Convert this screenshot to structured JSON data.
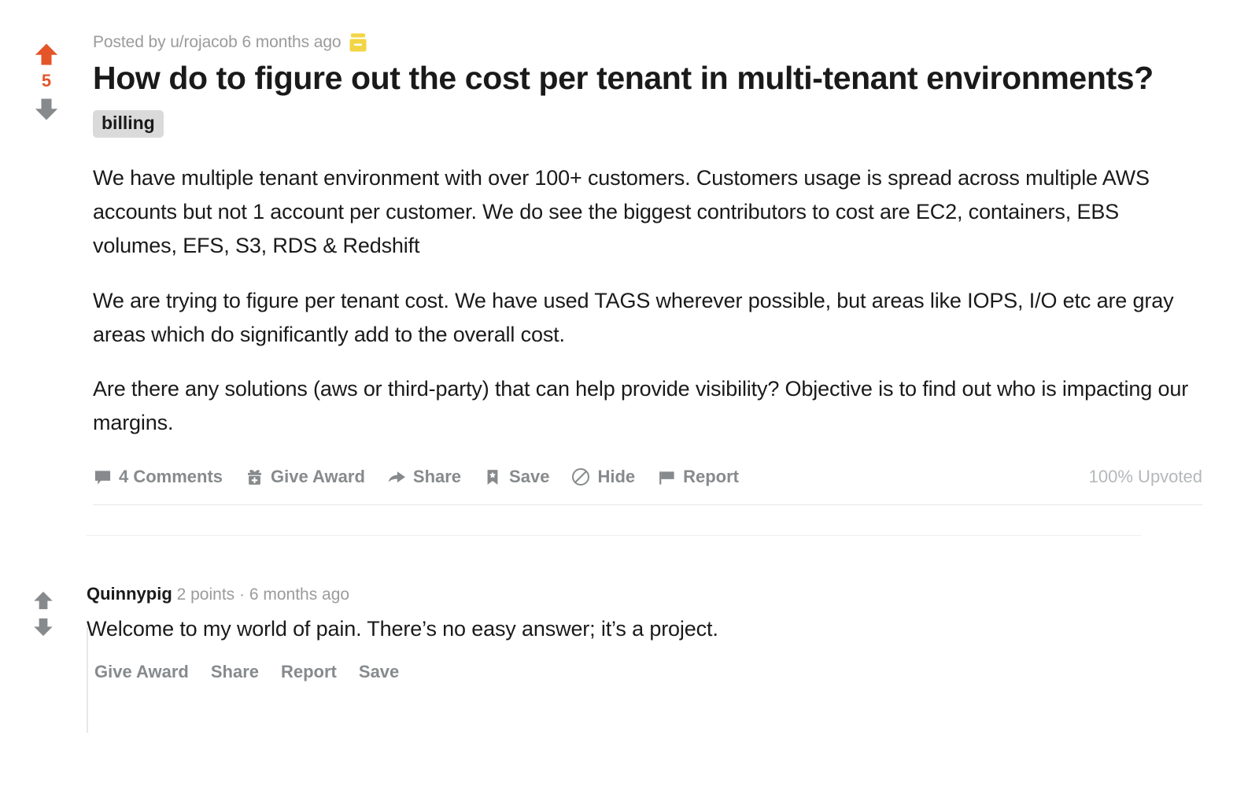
{
  "post": {
    "vote": {
      "upvote_icon": "upvote-arrow-icon",
      "score": "5",
      "downvote_icon": "downvote-arrow-icon",
      "upvote_color": "#e4552a",
      "downvote_color": "#878a8c"
    },
    "meta": "Posted by u/rojacob 6 months ago",
    "award_icon": "gold-award-badge-icon",
    "award_color": "#f2d544",
    "title": "How do to figure out the cost per tenant in multi-tenant environments?",
    "flair": "billing",
    "body": [
      "We have multiple tenant environment with over 100+ customers. Customers usage is spread across multiple AWS accounts but not 1 account per customer. We do see the biggest contributors to cost are EC2, containers, EBS volumes, EFS, S3, RDS & Redshift",
      "We are trying to figure per tenant cost. We have used TAGS wherever possible, but areas like IOPS, I/O etc are gray areas which do significantly add to the overall cost.",
      "Are there any solutions (aws or third-party) that can help provide visibility? Objective is to find out who is impacting our margins."
    ],
    "actions": [
      {
        "icon": "comment-bubble-icon",
        "label": "4 Comments"
      },
      {
        "icon": "gift-icon",
        "label": "Give Award"
      },
      {
        "icon": "share-arrow-icon",
        "label": "Share"
      },
      {
        "icon": "bookmark-star-icon",
        "label": "Save"
      },
      {
        "icon": "circle-slash-icon",
        "label": "Hide"
      },
      {
        "icon": "flag-icon",
        "label": "Report"
      }
    ],
    "upvoted_percent": "100% Upvoted"
  },
  "comments": [
    {
      "author": "Quinnypig",
      "meta": "2 points · 6 months ago",
      "text": "Welcome to my world of pain. There’s no easy answer; it’s a project.",
      "actions": [
        "Give Award",
        "Share",
        "Report",
        "Save"
      ]
    }
  ]
}
